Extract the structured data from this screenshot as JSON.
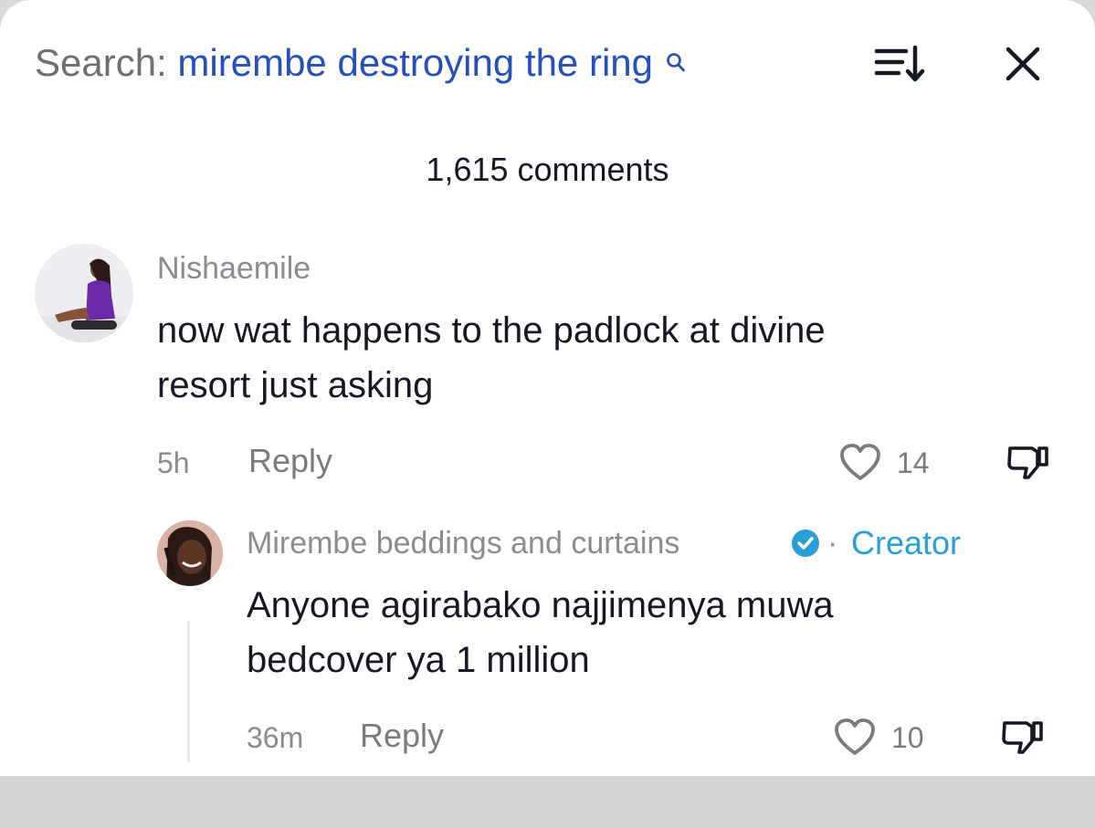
{
  "header": {
    "search_prefix": "Search:",
    "search_query": "mirembe destroying the ring",
    "search_icon": "search-icon",
    "sort_icon": "sort-icon",
    "close_icon": "close-icon"
  },
  "comment_count": "1,615 comments",
  "comments": [
    {
      "username": "Nishaemile",
      "text_line1": "now wat happens to the padlock at divine",
      "text_line2": "resort just asking",
      "time": "5h",
      "reply_label": "Reply",
      "likes": "14",
      "avatar": "avatar",
      "replies": [
        {
          "username": "Mirembe beddings and curtains",
          "verified_icon": "verified-icon",
          "separator": "·",
          "creator_label": "Creator",
          "text_line1": "Anyone agirabako najjimenya muwa",
          "text_line2": "bedcover ya 1 million",
          "time": "36m",
          "reply_label": "Reply",
          "likes": "10"
        }
      ]
    }
  ],
  "colors": {
    "query": "#2450b8",
    "muted": "#8a8b91",
    "creator": "#2a9fd6",
    "text": "#161823"
  }
}
